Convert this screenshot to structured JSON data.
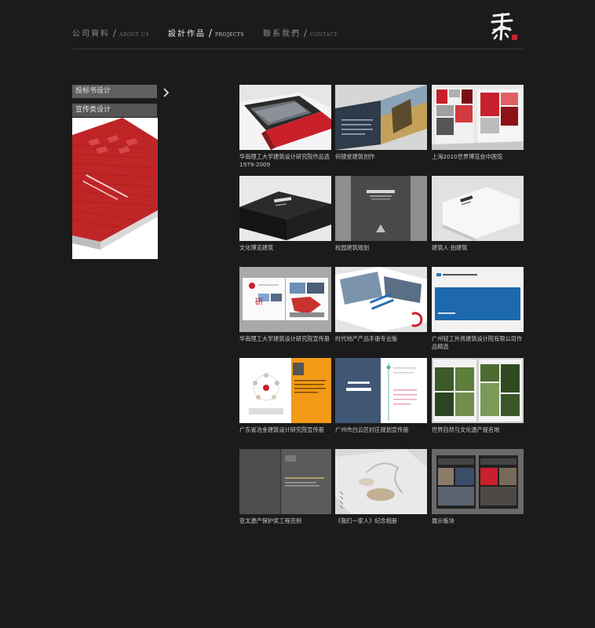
{
  "nav": [
    {
      "cn": "公司資料",
      "en": "ABOUT US"
    },
    {
      "cn": "設計作品",
      "en": "PROJECTS"
    },
    {
      "cn": "聯系我們",
      "en": "CONTACT"
    }
  ],
  "nav_slash": "/",
  "sidebar": {
    "items": [
      {
        "label": "投标书设计"
      },
      {
        "label": "宣传类设计"
      }
    ]
  },
  "projects": [
    {
      "caption": "华南理工大学建筑设计研究院作品选 1979-2009"
    },
    {
      "caption": "何镜堂建筑创作"
    },
    {
      "caption": "上海2010世界博览会中国馆"
    },
    {
      "caption": "文化博览建筑"
    },
    {
      "caption": "校园建筑规划"
    },
    {
      "caption": "建筑人·拍建筑"
    },
    {
      "caption": "华南理工大学建筑设计研究院宣传册"
    },
    {
      "caption": "时代地产产品手册专业版"
    },
    {
      "caption": "广州轻工外资建筑设计院有限公司作品精选"
    },
    {
      "caption": "广东省冶金建筑设计研究院宣传册"
    },
    {
      "caption": "广州市白云区村庄规划宣传册"
    },
    {
      "caption": "世界自然与文化遗产提名地"
    },
    {
      "caption": "亚太遗产保护奖工程范例"
    },
    {
      "caption": "《我们一家人》纪念相册"
    },
    {
      "caption": "展示板块"
    }
  ],
  "colors": {
    "background": "#1c1b1b",
    "accent_red": "#c0272d",
    "sidebar_button": "#555555"
  }
}
